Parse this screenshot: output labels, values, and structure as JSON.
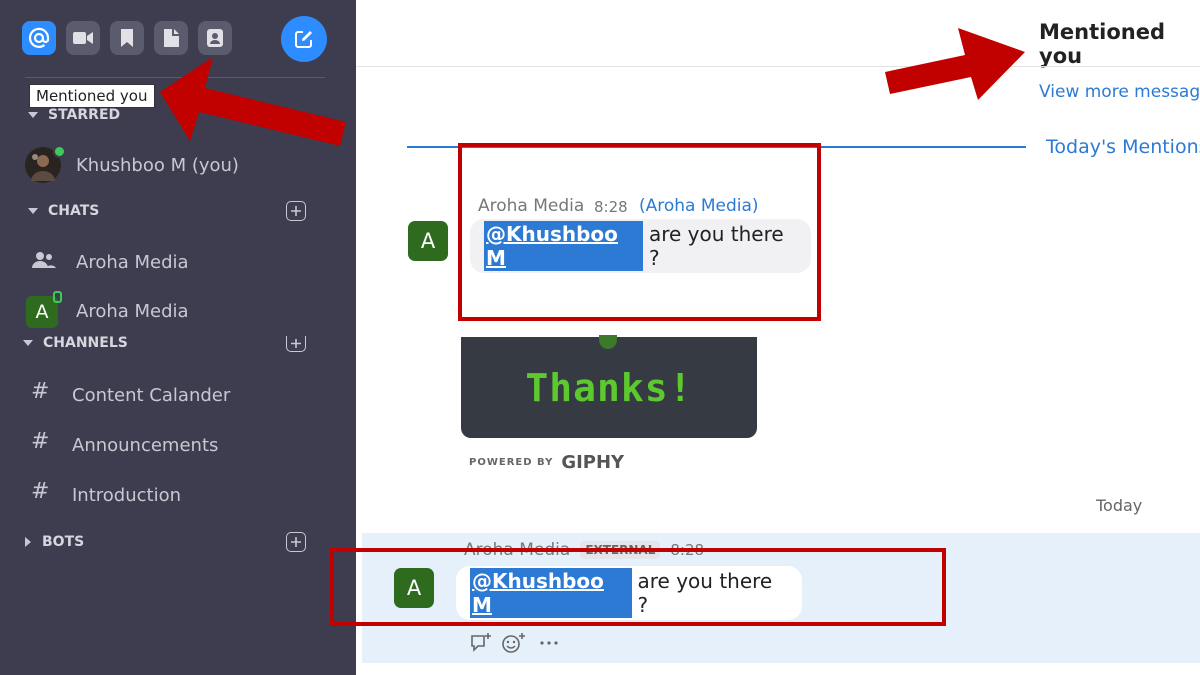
{
  "sidebar": {
    "top_icons": [
      "at-icon",
      "video-icon",
      "bookmark-icon",
      "file-icon",
      "contact-icon"
    ],
    "compose_icon": "compose-icon",
    "tooltip": "Mentioned you",
    "starred": {
      "label": "STARRED",
      "items": [
        {
          "label": "Khushboo M (you)"
        }
      ]
    },
    "chats": {
      "label": "CHATS",
      "items": [
        {
          "label": "Aroha Media",
          "icon": "group-icon"
        },
        {
          "label": "Aroha Media",
          "avatar": "A"
        }
      ]
    },
    "channels": {
      "label": "CHANNELS",
      "items": [
        {
          "hash": "#",
          "label": "Content Calander"
        },
        {
          "hash": "#",
          "label": "Announcements"
        },
        {
          "hash": "#",
          "label": "Introduction"
        }
      ]
    },
    "bots": {
      "label": "BOTS"
    }
  },
  "header": {
    "title": "Mentioned you"
  },
  "main": {
    "view_more": "View more messages",
    "todays_mentions": "Today's Mentions",
    "messages": [
      {
        "avatar": "A",
        "sender": "Aroha Media",
        "time": "8:28",
        "channel": "(Aroha Media)",
        "mention": "@Khushboo M",
        "text": "are you there ?"
      },
      {
        "avatar": "A",
        "sender": "Aroha Media",
        "badge": "EXTERNAL",
        "time": "8:28",
        "mention": "@Khushboo M",
        "text": "are you there ?"
      }
    ],
    "gif_text": "Thanks!",
    "powered_by": "POWERED BY",
    "giphy": "GIPHY",
    "date_divider": "Today"
  },
  "colors": {
    "sidebar_bg": "#3d3d4f",
    "accent": "#2d8cff",
    "annotation_red": "#c10000",
    "avatar_green": "#2e6b1e",
    "highlight_bg": "#e6f0fb"
  }
}
